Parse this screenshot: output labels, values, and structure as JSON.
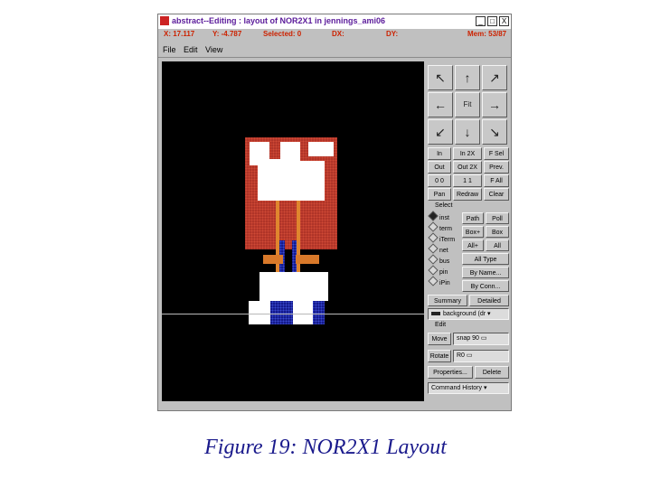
{
  "window": {
    "title": "abstract--Editing : layout of NOR2X1 in jennings_ami06",
    "buttons": [
      "_",
      "□",
      "X"
    ]
  },
  "status": {
    "x": "X: 17.117",
    "y": "Y: -4.787",
    "selected": "Selected: 0",
    "dx": "DX:",
    "dy": "DY:",
    "mem": "Mem: 53/87"
  },
  "menu": [
    "File",
    "Edit",
    "View"
  ],
  "panel": {
    "fit": "Fit",
    "zoom_buttons": [
      [
        "In",
        "In 2X",
        "F Sel"
      ],
      [
        "Out",
        "Out 2X",
        "Prev."
      ],
      [
        "0 0",
        "1 1",
        "F All"
      ],
      [
        "Pan",
        "Redraw",
        "Clear"
      ]
    ],
    "select_header": "Select",
    "select_options": [
      {
        "label": "inst",
        "selected": true
      },
      {
        "label": "term",
        "selected": false
      },
      {
        "label": "iTerm",
        "selected": false
      },
      {
        "label": "net",
        "selected": false
      },
      {
        "label": "bus",
        "selected": false
      },
      {
        "label": "pin",
        "selected": false
      },
      {
        "label": "iPin",
        "selected": false
      }
    ],
    "select_buttons": [
      "Path",
      "Poll",
      "Box+",
      "Box",
      "All+",
      "All",
      "All Type",
      "By Name...",
      "By Conn..."
    ],
    "summary": "Summary",
    "detailed": "Detailed",
    "layer_label": "background (dr",
    "edit_header": "Edit",
    "move": "Move",
    "snap_value": "snap 90",
    "rotate": "Rotate",
    "rotate_value": "R0",
    "properties": "Properties...",
    "delete": "Delete",
    "history": "Command History"
  },
  "caption": "Figure 19: NOR2X1 Layout"
}
